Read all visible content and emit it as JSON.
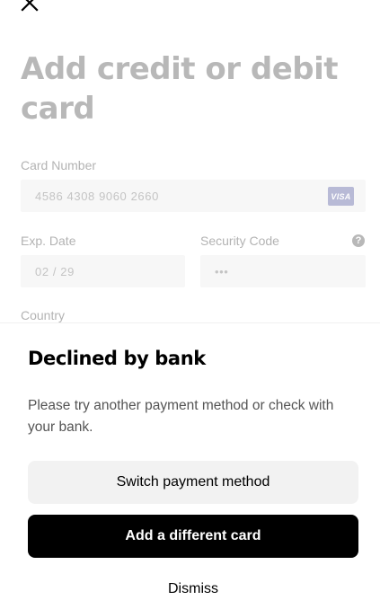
{
  "page": {
    "title": "Add credit or debit card"
  },
  "form": {
    "card_number": {
      "label": "Card Number",
      "value": "4586 4308 9060 2660",
      "brand_badge": "VISA"
    },
    "exp_date": {
      "label": "Exp. Date",
      "value": "02 / 29"
    },
    "security_code": {
      "label": "Security Code",
      "value": "•••",
      "help_glyph": "?"
    },
    "country": {
      "label": "Country"
    }
  },
  "dialog": {
    "title": "Declined by bank",
    "message": "Please try another payment method or check with your bank.",
    "switch_button": "Switch payment method",
    "add_card_button": "Add a different card",
    "dismiss_button": "Dismiss"
  },
  "icons": {
    "close": "close-icon",
    "help": "question-circle-icon"
  },
  "colors": {
    "primary_button": "#000000",
    "secondary_button": "#f2f2f2",
    "visa_badge": "#b8bad6",
    "muted_text": "#b3b3b3"
  }
}
